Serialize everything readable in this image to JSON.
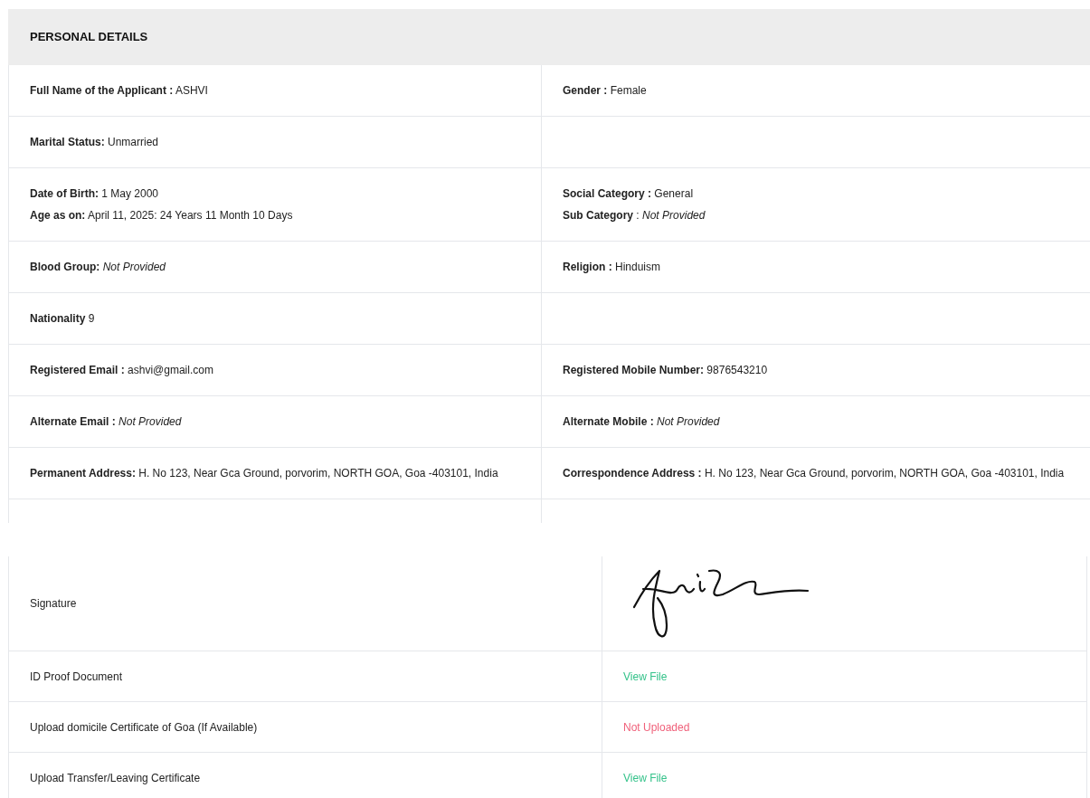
{
  "personal_details": {
    "title": "PERSONAL DETAILS",
    "rows": [
      {
        "left": [
          "**Full Name of the Applicant :** ASHVI"
        ],
        "right": [
          "**Gender :** Female"
        ]
      },
      {
        "left": [
          "**Marital Status:** Unmarried"
        ],
        "right": []
      },
      {
        "left": [
          "**Date of Birth:** 1 May 2000",
          "**Age as on:** April 11, 2025: 24 Years 11 Month 10 Days"
        ],
        "right": [
          "**Social Category :** General",
          "**Sub Category** : *Not Provided*"
        ]
      },
      {
        "left": [
          "**Blood Group:** *Not Provided*"
        ],
        "right": [
          "**Religion :** Hinduism"
        ]
      },
      {
        "left": [
          "**Nationality** 9"
        ],
        "right": []
      },
      {
        "left": [
          "**Registered Email :** ashvi@gmail.com"
        ],
        "right": [
          "**Registered Mobile Number:** 9876543210"
        ]
      },
      {
        "left": [
          "**Alternate Email :** *Not Provided*"
        ],
        "right": [
          "**Alternate Mobile :** *Not Provided*"
        ]
      },
      {
        "left": [
          "**Permanent Address:** H. No 123, Near Gca Ground, porvorim, NORTH GOA, Goa -403101, India"
        ],
        "right": [
          "**Correspondence Address :** H. No 123, Near Gca Ground, porvorim, NORTH GOA, Goa -403101, India"
        ]
      }
    ]
  },
  "documents": [
    {
      "label": "Signature",
      "kind": "signature"
    },
    {
      "label": "ID Proof Document",
      "kind": "file",
      "value": "View File"
    },
    {
      "label": "Upload domicile Certificate of Goa (If Available)",
      "kind": "missing",
      "value": "Not Uploaded"
    },
    {
      "label": "Upload Transfer/Leaving Certificate",
      "kind": "file",
      "value": "View File"
    }
  ]
}
